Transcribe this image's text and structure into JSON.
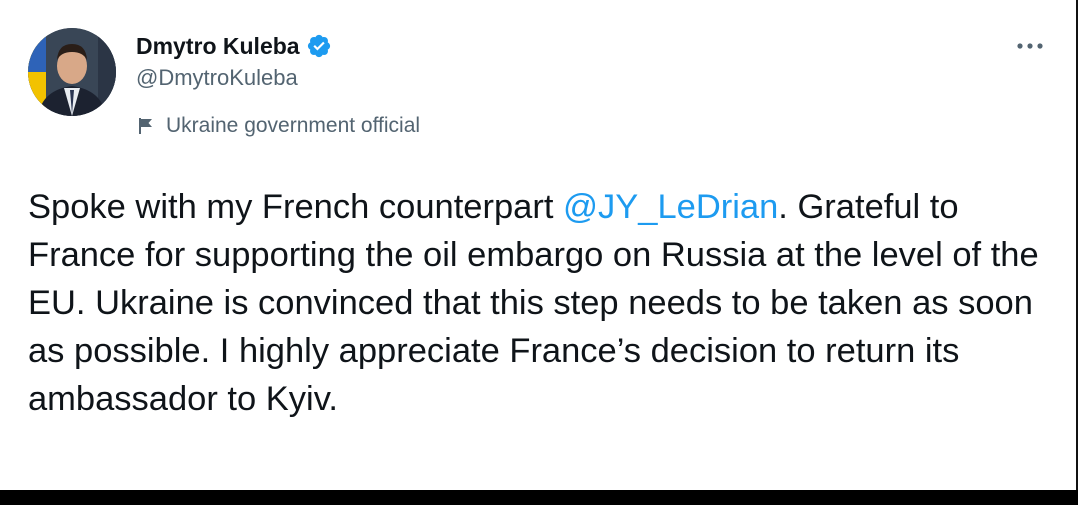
{
  "author": {
    "display_name": "Dmytro Kuleba",
    "handle": "@DmytroKuleba",
    "verified": true,
    "label": "Ukraine government official",
    "label_icon": "flag-icon",
    "avatar_icon": "avatar"
  },
  "menu": {
    "icon": "more-horizontal-icon"
  },
  "tweet": {
    "text_before": "Spoke with my French counterpart ",
    "mention": "@JY_LeDrian",
    "text_after": ". Grateful to France for supporting the oil embargo on Russia at the level of the EU. Ukraine is convinced that this step needs to be taken as soon as possible. I highly appreciate France’s decision to return its ambassador to Kyiv."
  },
  "colors": {
    "text": "#0f1419",
    "secondary": "#536471",
    "accent": "#1d9bf0"
  }
}
